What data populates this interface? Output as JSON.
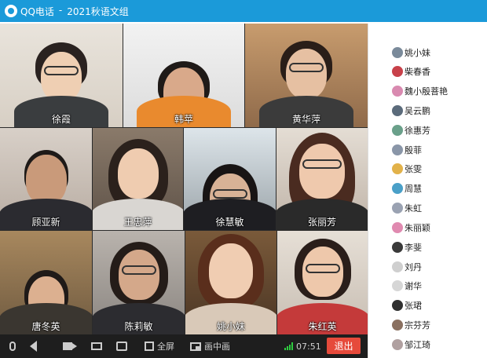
{
  "window": {
    "app_name": "QQ电话",
    "separator": "-",
    "group_name": "2021秋语文组"
  },
  "video_tiles": [
    {
      "name": "徐霞"
    },
    {
      "name": "韩苹"
    },
    {
      "name": "黄华萍"
    },
    {
      "name": "顾亚新"
    },
    {
      "name": "王忠萍"
    },
    {
      "name": "徐慧敏"
    },
    {
      "name": "张丽芳"
    },
    {
      "name": "唐冬英"
    },
    {
      "name": "陈莉敏"
    },
    {
      "name": "姚小妹"
    },
    {
      "name": "朱红英"
    }
  ],
  "members": [
    {
      "name": "姚小妹"
    },
    {
      "name": "柴春香"
    },
    {
      "name": "魏小殷菩艳"
    },
    {
      "name": "吴云鹏"
    },
    {
      "name": "徐惠芳"
    },
    {
      "name": "殷菲"
    },
    {
      "name": "张雯"
    },
    {
      "name": "周慧"
    },
    {
      "name": "朱虹"
    },
    {
      "name": "朱丽颖"
    },
    {
      "name": "李斐"
    },
    {
      "name": "刘丹"
    },
    {
      "name": "谢华"
    },
    {
      "name": "张珺"
    },
    {
      "name": "宗芬芳"
    },
    {
      "name": "邹江琦"
    }
  ],
  "toolbar": {
    "fullscreen_label": "全屏",
    "pip_label": "画中画",
    "time": "07:51",
    "exit_label": "退出"
  },
  "colors": {
    "titlebar": "#1b9ad9",
    "exit_button": "#e64a3b",
    "signal": "#2ecc40",
    "toolbar_bg": "#1e1e1e"
  },
  "icons": {
    "mic": "microphone-icon",
    "speaker": "speaker-icon",
    "camera": "camera-icon",
    "share": "screen-share-icon",
    "person": "person-view-icon",
    "fullscreen": "fullscreen-icon",
    "pip": "picture-in-picture-icon",
    "signal": "signal-icon"
  }
}
